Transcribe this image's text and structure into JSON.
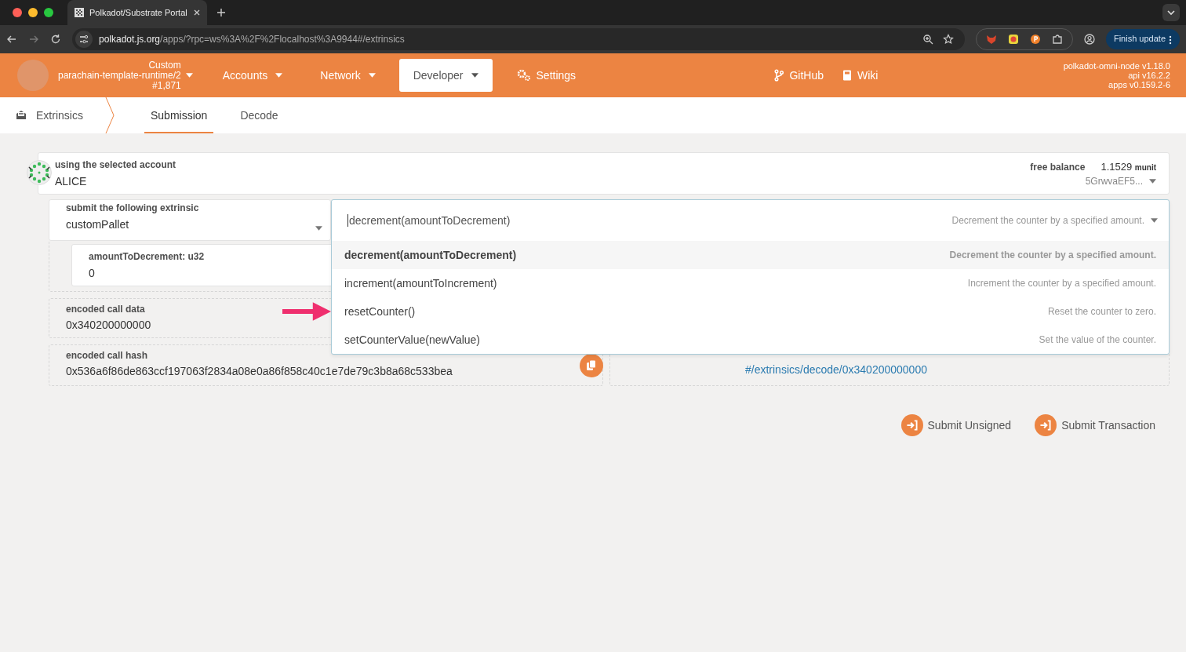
{
  "browser": {
    "tab_title": "Polkadot/Substrate Portal",
    "url_host": "polkadot.js.org",
    "url_path": "/apps/?rpc=ws%3A%2F%2Flocalhost%3A9944#/extrinsics",
    "update_button": "Finish update"
  },
  "nav": {
    "chain": {
      "name": "Custom",
      "runtime": "parachain-template-runtime/2",
      "block": "#1,871"
    },
    "menu": [
      {
        "label": "Accounts",
        "selected": false
      },
      {
        "label": "Network",
        "selected": false
      },
      {
        "label": "Developer",
        "selected": true
      }
    ],
    "settings": "Settings",
    "links": [
      "GitHub",
      "Wiki"
    ],
    "versions": [
      "polkadot-omni-node v1.18.0",
      "api v16.2.2",
      "apps v0.159.2-6"
    ]
  },
  "subnav": {
    "section": "Extrinsics",
    "tabs": [
      {
        "label": "Submission",
        "selected": true
      },
      {
        "label": "Decode",
        "selected": false
      }
    ]
  },
  "account": {
    "label": "using the selected account",
    "name": "ALICE",
    "balance_label": "free balance",
    "balance_value": "1.1529",
    "balance_unit": "munit",
    "address": "5GrwvaEF5..."
  },
  "extrinsic": {
    "label": "submit the following extrinsic",
    "pallet": "customPallet",
    "call": {
      "value": "decrement(amountToDecrement)",
      "description": "Decrement the counter by a specified amount.",
      "options": [
        {
          "name": "decrement(amountToDecrement)",
          "description": "Decrement the counter by a specified amount.",
          "selected": true,
          "pointed": false
        },
        {
          "name": "increment(amountToIncrement)",
          "description": "Increment the counter by a specified amount.",
          "selected": false,
          "pointed": false
        },
        {
          "name": "resetCounter()",
          "description": "Reset the counter to zero.",
          "selected": false,
          "pointed": true
        },
        {
          "name": "setCounterValue(newValue)",
          "description": "Set the value of the counter.",
          "selected": false,
          "pointed": false
        }
      ]
    }
  },
  "params": [
    {
      "label": "amountToDecrement: u32",
      "value": "0"
    }
  ],
  "call_data": {
    "label": "encoded call data",
    "value": "0x340200000000"
  },
  "call_hash": {
    "label": "encoded call hash",
    "value": "0x536a6f86de863ccf197063f2834a08e0a86f858c40c1e7de79c3b8a68c533bea"
  },
  "decode_link": "#/extrinsics/decode/0x340200000000",
  "buttons": [
    "Submit Unsigned",
    "Submit Transaction"
  ]
}
